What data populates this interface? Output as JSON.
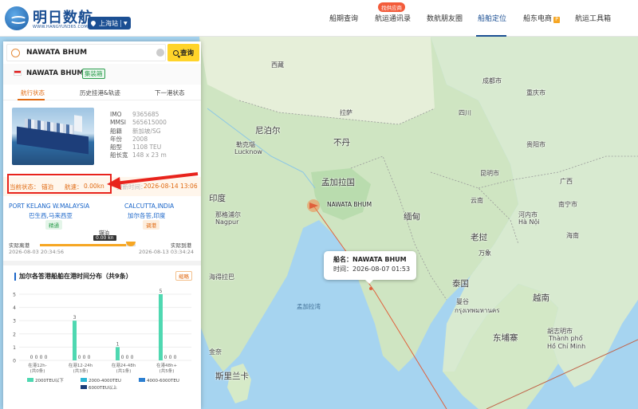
{
  "header": {
    "logo_text": "明日数航",
    "logo_sub": "WWW.HANGYUN365.COM",
    "station": "上海站",
    "nav": [
      {
        "label": "船期查询"
      },
      {
        "label": "航运通讯录"
      },
      {
        "label": "数航朋友圈"
      },
      {
        "label": "船舶定位"
      },
      {
        "label": "船东电商"
      },
      {
        "label": "航运工具箱"
      }
    ],
    "nav_badge": "找供应商",
    "pro_icon": "P"
  },
  "search": {
    "value": "NAWATA BHUM",
    "button": "查询"
  },
  "ship": {
    "name": "NAWATA BHUM",
    "type": "集装箱",
    "flag_color": "#e02020",
    "tabs": [
      "航行状态",
      "历史挂港&轨迹",
      "下一港状态"
    ],
    "info": [
      {
        "k": "IMO",
        "v": "9365685"
      },
      {
        "k": "MMSI",
        "v": "565615000"
      },
      {
        "k": "船籍",
        "v": "新加坡/SG"
      },
      {
        "k": "年份",
        "v": "2008"
      },
      {
        "k": "船型",
        "v": "1108 TEU"
      },
      {
        "k": "船长宽",
        "v": "148 x 23 m"
      }
    ],
    "status_label": "当前状态：",
    "status_value": "锚泊",
    "speed_label": "航速：",
    "speed_value": "0.00kn",
    "update_label": "更新时间：",
    "update_value": "2026-08-14 13:06"
  },
  "voyage": {
    "from_port": "PORT KELANG W.MALAYSIA",
    "from_cn": "巴生西,马来西亚",
    "from_tag": "精通",
    "to_port": "CALCUTTA,INDIA",
    "to_cn": "加尔各答,印度",
    "to_tag": "调港",
    "mid_status": "锚泊",
    "mid_speed": "0.00 kn",
    "progress": 0.9,
    "dep_label": "实际离港",
    "dep_time": "2026-08-03 20:34:56",
    "arr_label": "实际到港",
    "arr_time": "2026-08-13 03:34:24"
  },
  "section": {
    "title": "加尔各答港船舶在港时间分布（共9条）",
    "zoom_btn": "缩略"
  },
  "chart_data": {
    "type": "bar",
    "categories": [
      "在港12h-\n(共0条)",
      "在港12-24h\n(共3条)",
      "在港24-48h\n(共1条)",
      "在港48h+\n(共5条)"
    ],
    "category_lines": [
      [
        "在港12h-",
        "(共0条)"
      ],
      [
        "在港12-24h",
        "(共3条)"
      ],
      [
        "在港24-48h",
        "(共1条)"
      ],
      [
        "在港48h+",
        "(共5条)"
      ]
    ],
    "series": [
      {
        "name": "2000TEU以下",
        "color": "#4fd8b1",
        "values": [
          0,
          3,
          1,
          5
        ]
      },
      {
        "name": "2000-4000TEU",
        "color": "#2bb6d6",
        "values": [
          0,
          0,
          0,
          0
        ]
      },
      {
        "name": "4000-6000TEU",
        "color": "#2c7fd1",
        "values": [
          0,
          0,
          0,
          0
        ]
      },
      {
        "name": "6000TEU以上",
        "color": "#1a3d7a",
        "values": [
          0,
          0,
          0,
          0
        ]
      }
    ],
    "y_ticks": [
      0,
      1,
      2,
      3,
      4,
      5
    ],
    "ylim": [
      0,
      5
    ]
  },
  "map": {
    "popup_name_label": "船名：",
    "popup_name": "NAWATA BHUM",
    "popup_time_label": "时间：",
    "popup_time": "2026-08-07 01:53",
    "ship_tag": "NAWATA BHUM",
    "labels": [
      {
        "t": "尼泊尔",
        "c": "country"
      },
      {
        "t": "勒克瑙",
        "c": ""
      },
      {
        "t": "Lucknow",
        "c": ""
      },
      {
        "t": "不丹",
        "c": "country"
      },
      {
        "t": "孟加拉国",
        "c": "country"
      },
      {
        "t": "印度",
        "c": "country"
      },
      {
        "t": "那格浦尔",
        "c": ""
      },
      {
        "t": "Nagpur",
        "c": ""
      },
      {
        "t": "缅甸",
        "c": "country"
      },
      {
        "t": "老挝",
        "c": "country"
      },
      {
        "t": "泰国",
        "c": "country"
      },
      {
        "t": "越南",
        "c": "country"
      },
      {
        "t": "东埔寨",
        "c": "country"
      },
      {
        "t": "河内市",
        "c": ""
      },
      {
        "t": "Hà Nội",
        "c": ""
      },
      {
        "t": "曼谷",
        "c": ""
      },
      {
        "t": "กรุงเทพมหานคร",
        "c": ""
      },
      {
        "t": "胡志明市",
        "c": ""
      },
      {
        "t": "Thành phố",
        "c": ""
      },
      {
        "t": "Hồ Chí Minh",
        "c": ""
      },
      {
        "t": "斯里兰卡",
        "c": "country"
      },
      {
        "t": "孟加拉湾",
        "c": "sea"
      },
      {
        "t": "海得拉巴",
        "c": ""
      },
      {
        "t": "金奈",
        "c": ""
      },
      {
        "t": "重庆市",
        "c": ""
      },
      {
        "t": "成都市",
        "c": ""
      },
      {
        "t": "贵阳市",
        "c": ""
      },
      {
        "t": "昆明市",
        "c": ""
      },
      {
        "t": "南宁市",
        "c": ""
      },
      {
        "t": "西藏",
        "c": ""
      },
      {
        "t": "拉萨",
        "c": ""
      },
      {
        "t": "四川",
        "c": ""
      },
      {
        "t": "云南",
        "c": ""
      },
      {
        "t": "广西",
        "c": ""
      },
      {
        "t": "海南",
        "c": ""
      },
      {
        "t": "万象",
        "c": ""
      }
    ]
  }
}
